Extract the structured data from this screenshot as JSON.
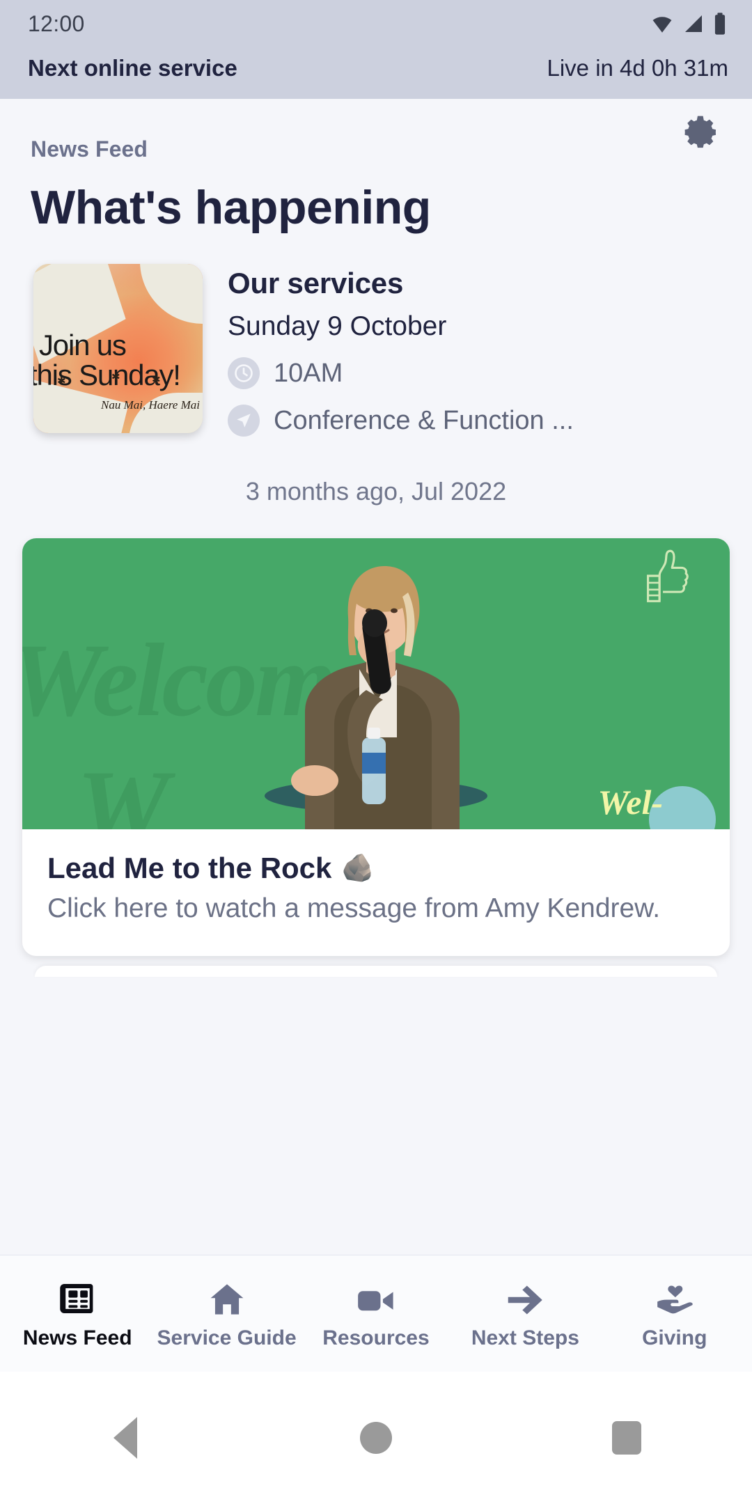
{
  "status_bar": {
    "time": "12:00",
    "icons": [
      "wifi-icon",
      "cellular-signal-icon",
      "battery-icon"
    ]
  },
  "banner": {
    "label": "Next online service",
    "countdown": "Live in 4d 0h 31m"
  },
  "header": {
    "eyebrow": "News Feed",
    "title": "What's happening",
    "settings_icon": "gear-icon"
  },
  "service_card": {
    "thumbnail": {
      "line1": "Join us",
      "line2": "this Sunday!",
      "caption": "Nau Mai, Haere Mai"
    },
    "title": "Our services",
    "date": "Sunday 9 October",
    "time": "10AM",
    "time_icon": "clock-icon",
    "location": "Conference & Function ...",
    "location_icon": "navigation-arrow-icon"
  },
  "timestamp": "3 months ago, Jul 2022",
  "post": {
    "hero": {
      "background_word": "Welcome",
      "accent_word": "Wel-",
      "thumbs_up_icon": "thumbs-up-outline-icon"
    },
    "title": "Lead Me to the Rock",
    "title_emoji": "🪨",
    "description": "Click here to watch a message from Amy Kendrew."
  },
  "tabs": [
    {
      "label": "News Feed",
      "icon": "newspaper-icon",
      "active": true
    },
    {
      "label": "Service Guide",
      "icon": "home-icon",
      "active": false
    },
    {
      "label": "Resources",
      "icon": "video-camera-icon",
      "active": false
    },
    {
      "label": "Next Steps",
      "icon": "arrow-right-icon",
      "active": false
    },
    {
      "label": "Giving",
      "icon": "hand-heart-icon",
      "active": false
    }
  ],
  "system_nav": {
    "back": "back-triangle-icon",
    "home": "home-circle-icon",
    "recents": "recents-square-icon"
  },
  "colors": {
    "banner_bg": "#ccd0de",
    "page_bg": "#f5f6fa",
    "title": "#20233f",
    "muted": "#6b718c",
    "hero_green": "#46a868"
  }
}
